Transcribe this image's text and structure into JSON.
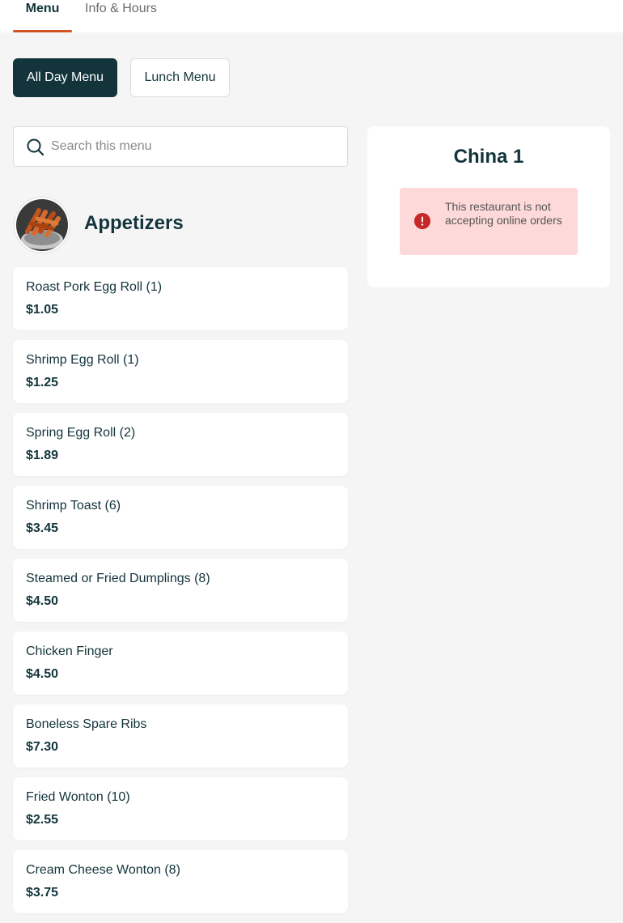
{
  "tabs": [
    {
      "label": "Menu",
      "active": true
    },
    {
      "label": "Info & Hours",
      "active": false
    }
  ],
  "menus": [
    {
      "label": "All Day Menu",
      "selected": true
    },
    {
      "label": "Lunch Menu",
      "selected": false
    }
  ],
  "search": {
    "placeholder": "Search this menu",
    "value": ""
  },
  "category": {
    "title": "Appetizers",
    "image": "egg-roll-photo"
  },
  "items": [
    {
      "name": "Roast Pork Egg Roll (1)",
      "price": "$1.05"
    },
    {
      "name": "Shrimp Egg Roll (1)",
      "price": "$1.25"
    },
    {
      "name": "Spring Egg Roll (2)",
      "price": "$1.89"
    },
    {
      "name": "Shrimp Toast (6)",
      "price": "$3.45"
    },
    {
      "name": "Steamed or Fried Dumplings (8)",
      "price": "$4.50"
    },
    {
      "name": "Chicken Finger",
      "price": "$4.50"
    },
    {
      "name": "Boneless Spare Ribs",
      "price": "$7.30"
    },
    {
      "name": "Fried Wonton (10)",
      "price": "$2.55"
    },
    {
      "name": "Cream Cheese Wonton (8)",
      "price": "$3.75"
    }
  ],
  "restaurant": {
    "name": "China 1",
    "alert": "This restaurant is not accepting online orders"
  },
  "colors": {
    "primary": "#13343b",
    "accent": "#d2541f",
    "alert_bg": "#fdd9d9",
    "alert_icon": "#c62828"
  }
}
